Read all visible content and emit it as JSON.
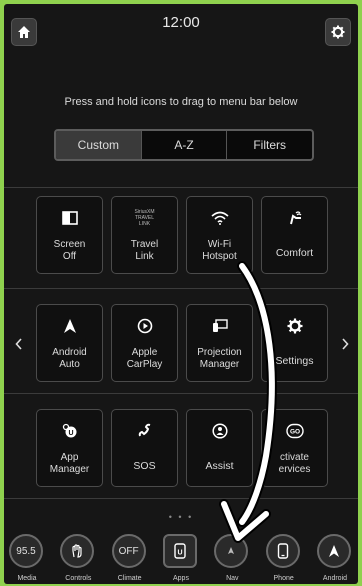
{
  "status_bar": {
    "time": "12:00"
  },
  "instruction": "Press and hold icons to drag to menu bar below",
  "tabs": [
    {
      "label": "Custom",
      "active": true
    },
    {
      "label": "A-Z",
      "active": false
    },
    {
      "label": "Filters",
      "active": false
    }
  ],
  "apps": [
    {
      "label": "Screen\nOff",
      "icon": "screen-off-icon"
    },
    {
      "label": "Travel\nLink",
      "icon": "siriusxm-travel-link-icon",
      "icon_text": "SiriusXM\nTRAVEL\nLINK"
    },
    {
      "label": "Wi-Fi\nHotspot",
      "icon": "wifi-icon"
    },
    {
      "label": "Comfort",
      "icon": "seat-comfort-icon"
    },
    {
      "label": "Android\nAuto",
      "icon": "android-auto-icon"
    },
    {
      "label": "Apple\nCarPlay",
      "icon": "carplay-icon"
    },
    {
      "label": "Projection\nManager",
      "icon": "projection-icon"
    },
    {
      "label": "Settings",
      "icon": "gear-icon"
    },
    {
      "label": "App\nManager",
      "icon": "app-manager-icon"
    },
    {
      "label": "SOS",
      "icon": "sos-icon"
    },
    {
      "label": "Assist",
      "icon": "assist-icon"
    },
    {
      "label": "ctivate\nervices",
      "icon": "go-icon"
    }
  ],
  "pager": {
    "dots": "• • •"
  },
  "dock": [
    {
      "label": "Media",
      "icon": "radio-icon",
      "value": "95.5"
    },
    {
      "label": "Controls",
      "icon": "hand-icon"
    },
    {
      "label": "Climate",
      "icon": "climate-icon",
      "value": "OFF"
    },
    {
      "label": "Apps",
      "icon": "apps-icon"
    },
    {
      "label": "Nav",
      "icon": "nav-icon"
    },
    {
      "label": "Phone",
      "icon": "phone-icon"
    },
    {
      "label": "Android",
      "icon": "android-auto-icon"
    }
  ],
  "colors": {
    "background": "#161616",
    "frame": "#8fd14e",
    "text": "#dcdcdc"
  }
}
